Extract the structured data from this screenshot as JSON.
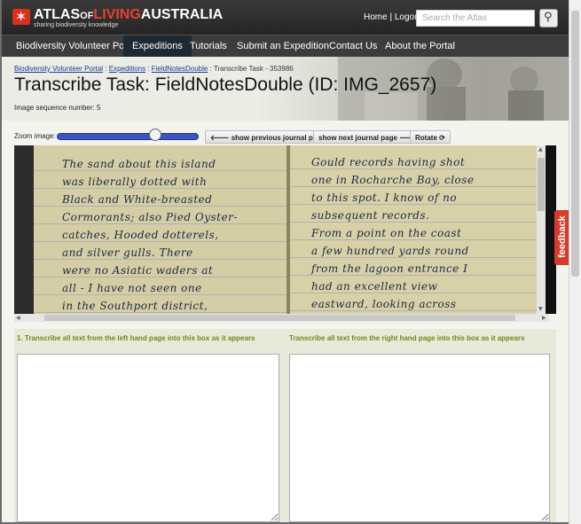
{
  "header": {
    "logo_atlas": "ATLAS",
    "logo_of": "OF",
    "logo_living": "LIVING",
    "logo_australia": "AUSTRALIA",
    "logo_tagline": "sharing biodiversity knowledge",
    "home_link": "Home",
    "separator": " | ",
    "logout_link": "Logout",
    "search_placeholder": "Search the Atlas"
  },
  "nav": {
    "items": [
      {
        "label": "Biodiversity Volunteer Portal"
      },
      {
        "label": "Expeditions"
      },
      {
        "label": "Tutorials"
      },
      {
        "label": "Submit an Expedition"
      },
      {
        "label": "Contact Us"
      },
      {
        "label": "About the Portal"
      }
    ]
  },
  "breadcrumb": {
    "items": [
      "Biodiversity Volunteer Portal",
      "Expeditions",
      "FieldNotesDouble"
    ],
    "sep": " : ",
    "current": "Transcribe Task - 353986"
  },
  "page": {
    "title": "Transcribe Task: FieldNotesDouble (ID: IMG_2657)",
    "sequence": "Image sequence number: 5"
  },
  "toolbar": {
    "zoom_label": "Zoom image:",
    "zoom_level": 0.7,
    "prev_label": "show previous journal page",
    "next_label": "show next journal page",
    "rotate_label": "Rotate"
  },
  "journal": {
    "left_lines": [
      "The sand about this island",
      "was liberally dotted with",
      "Black and White-breasted",
      "Cormorants; also Pied Oyster-",
      "catches, Hooded dotterels,",
      "and silver gulls.  There",
      "were no Asiatic waders at",
      "all - I have not seen one",
      "in the Southport district,"
    ],
    "right_lines": [
      "Gould records having shot",
      "one in Rocharche Bay, close",
      "to this spot. I know of no",
      "subsequent records.",
      "From a point on the coast",
      "a few hundred yards round",
      "from the lagoon entrance I",
      "had an excellent view",
      "eastward, looking across"
    ]
  },
  "transcription": {
    "left_label": "1. Transcribe all text from the left hand page into this box as it appears",
    "right_label": "Transcribe all text from the right hand page into this box as it appears"
  },
  "feedback": {
    "label": "feedback"
  },
  "colors": {
    "header_bg": "#2e2e2e",
    "nav_bg": "#3c3c3c",
    "living_red": "#e6412b",
    "zoom_blue": "#3d52c4",
    "label_green": "#6b8a1f",
    "feedback_red": "#d63b2b"
  }
}
